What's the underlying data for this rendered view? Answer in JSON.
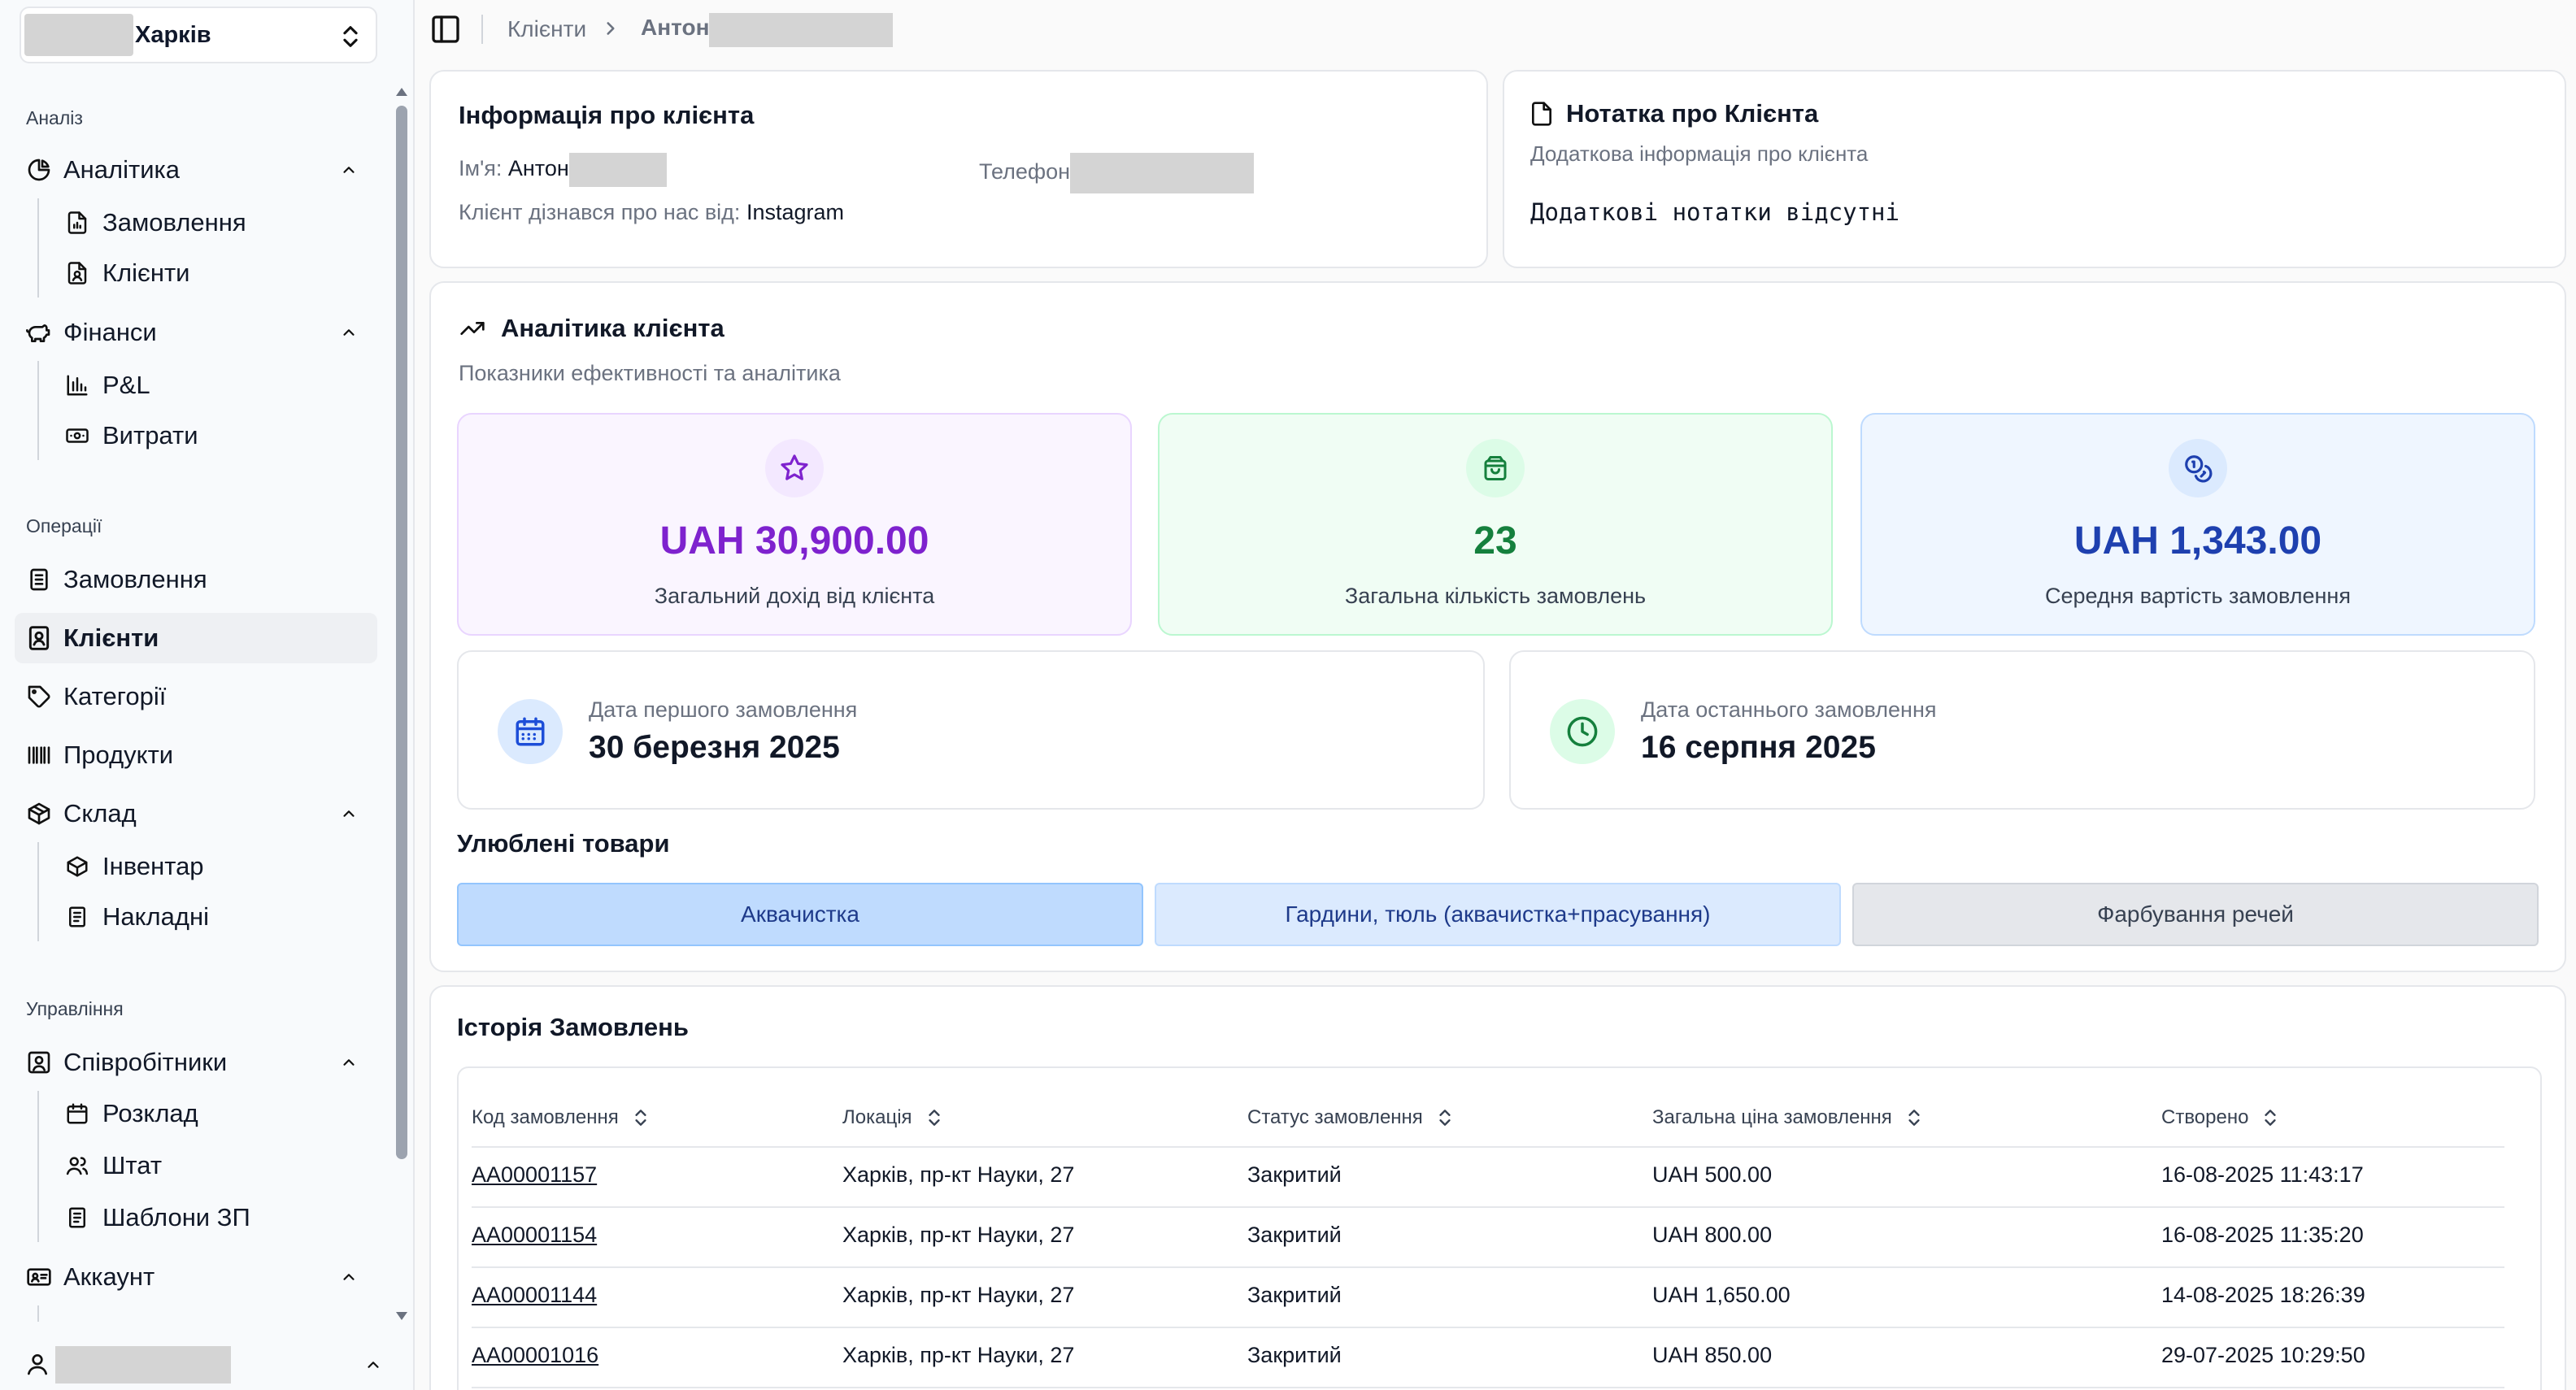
{
  "location_selector": {
    "value": "Харків"
  },
  "sidebar": {
    "sections": [
      {
        "label": "Аналіз"
      },
      {
        "label": "Операції"
      },
      {
        "label": "Управління"
      }
    ],
    "analytics": {
      "label": "Аналітика",
      "children": [
        "Замовлення",
        "Клієнти"
      ]
    },
    "finance": {
      "label": "Фінанси",
      "children": [
        "P&L",
        "Витрати"
      ]
    },
    "ops": [
      "Замовлення",
      "Клієнти",
      "Категорії",
      "Продукти"
    ],
    "warehouse": {
      "label": "Склад",
      "children": [
        "Інвентар",
        "Накладні"
      ]
    },
    "staff": {
      "label": "Співробітники",
      "children": [
        "Розклад",
        "Штат",
        "Шаблони ЗП"
      ]
    },
    "account": {
      "label": "Аккаунт"
    }
  },
  "breadcrumb": {
    "parent": "Клієнти",
    "current": "Антон"
  },
  "client_info": {
    "title": "Інформація про клієнта",
    "name_label": "Ім'я:",
    "name_value": "Антон",
    "phone_label": "Телефон",
    "source_label": "Клієнт дізнався про нас від:",
    "source_value": "Instagram"
  },
  "note": {
    "title": "Нотатка про Клієнта",
    "subtitle": "Додаткова інформація про клієнта",
    "body": "Додаткові нотатки відсутні"
  },
  "analytics": {
    "title": "Аналітика клієнта",
    "subtitle": "Показники ефективності та аналітика",
    "stats": [
      {
        "value": "UAH 30,900.00",
        "caption": "Загальний дохід від клієнта",
        "icon": "star-icon",
        "color": "#7e22ce"
      },
      {
        "value": "23",
        "caption": "Загальна кількість замовлень",
        "icon": "shopping-bag-icon",
        "color": "#15803d"
      },
      {
        "value": "UAH 1,343.00",
        "caption": "Середня вартість замовлення",
        "icon": "coins-icon",
        "color": "#1e40af"
      }
    ],
    "first_order": {
      "label": "Дата першого замовлення",
      "value": "30 березня 2025",
      "icon": "calendar-icon"
    },
    "last_order": {
      "label": "Дата останнього замовлення",
      "value": "16 серпня 2025",
      "icon": "clock-icon"
    },
    "favorites_title": "Улюблені товари",
    "favorites": [
      "Аквачистка",
      "Гардини, тюль (аквачистка+прасування)",
      "Фарбування речей"
    ]
  },
  "history": {
    "title": "Історія Замовлень",
    "columns": [
      "Код замовлення",
      "Локація",
      "Статус замовлення",
      "Загальна ціна замовлення",
      "Створено"
    ],
    "rows": [
      [
        "AA00001157",
        "Харків, пр-кт Науки, 27",
        "Закритий",
        "UAH 500.00",
        "16-08-2025 11:43:17"
      ],
      [
        "AA00001154",
        "Харків, пр-кт Науки, 27",
        "Закритий",
        "UAH 800.00",
        "16-08-2025 11:35:20"
      ],
      [
        "AA00001144",
        "Харків, пр-кт Науки, 27",
        "Закритий",
        "UAH 1,650.00",
        "14-08-2025 18:26:39"
      ],
      [
        "AA00001016",
        "Харків, пр-кт Науки, 27",
        "Закритий",
        "UAH 850.00",
        "29-07-2025 10:29:50"
      ]
    ]
  },
  "colors": {
    "accent_purple": "#7e22ce",
    "accent_green": "#15803d",
    "accent_blue": "#1e40af",
    "fav_active": "#bfdbfe"
  }
}
